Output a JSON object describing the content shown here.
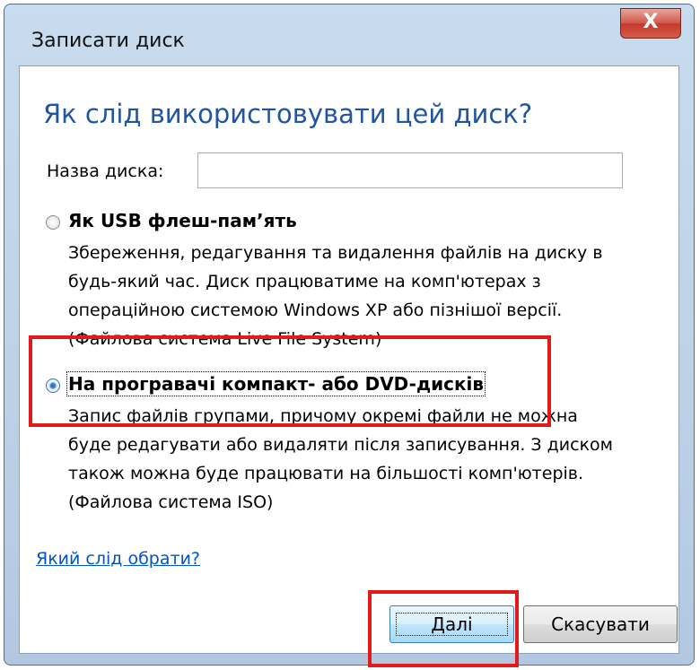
{
  "window": {
    "title": "Записати диск",
    "close_glyph": "X"
  },
  "dialog": {
    "heading": "Як слід використовувати цей диск?",
    "disc_name_label": "Назва диска:",
    "disc_name_value": "",
    "options": [
      {
        "title": "Як USB флеш-пам’ять",
        "description": "Збереження, редагування та видалення файлів на диску в\nбудь-який час. Диск працюватиме на комп'ютерах з\nопераційною системою Windows XP або пізнішої версії.\n(Файлова система Live File System)",
        "selected": false
      },
      {
        "title": "На програвачі компакт- або DVD-дисків",
        "description": "Запис файлів групами, причому окремі файли не можна\nбуде редагувати або видаляти після записування. З диском\nтакож можна буде працювати на більшості комп'ютерів.\n(Файлова система ISO)",
        "selected": true
      }
    ],
    "help_link": "Який слід обрати?"
  },
  "buttons": {
    "next_label": "Далі",
    "cancel_label": "Скасувати"
  },
  "colors": {
    "heading": "#1f55a3",
    "link": "#0054c6",
    "highlight": "#e21a1a"
  }
}
